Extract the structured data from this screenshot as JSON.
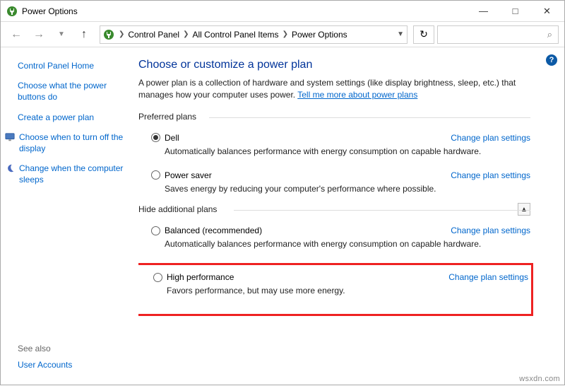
{
  "window": {
    "title": "Power Options"
  },
  "breadcrumb": {
    "items": [
      "Control Panel",
      "All Control Panel Items",
      "Power Options"
    ]
  },
  "help_tooltip": "?",
  "sidebar": {
    "home": "Control Panel Home",
    "links": [
      "Choose what the power buttons do",
      "Create a power plan",
      "Choose when to turn off the display",
      "Change when the computer sleeps"
    ],
    "see_also_label": "See also",
    "see_also": [
      "User Accounts"
    ]
  },
  "main": {
    "title": "Choose or customize a power plan",
    "intro_a": "A power plan is a collection of hardware and system settings (like display brightness, sleep, etc.) that manages how your computer uses power. ",
    "intro_link": "Tell me more about power plans",
    "preferred_label": "Preferred plans",
    "hide_label": "Hide additional plans",
    "change_link": "Change plan settings",
    "plans_pref": [
      {
        "name": "Dell",
        "desc": "Automatically balances performance with energy consumption on capable hardware.",
        "checked": true
      },
      {
        "name": "Power saver",
        "desc": "Saves energy by reducing your computer's performance where possible.",
        "checked": false
      }
    ],
    "plans_add": [
      {
        "name": "Balanced (recommended)",
        "desc": "Automatically balances performance with energy consumption on capable hardware.",
        "checked": false
      },
      {
        "name": "High performance",
        "desc": "Favors performance, but may use more energy.",
        "checked": false,
        "highlight": true
      }
    ]
  },
  "watermark": "wsxdn.com"
}
